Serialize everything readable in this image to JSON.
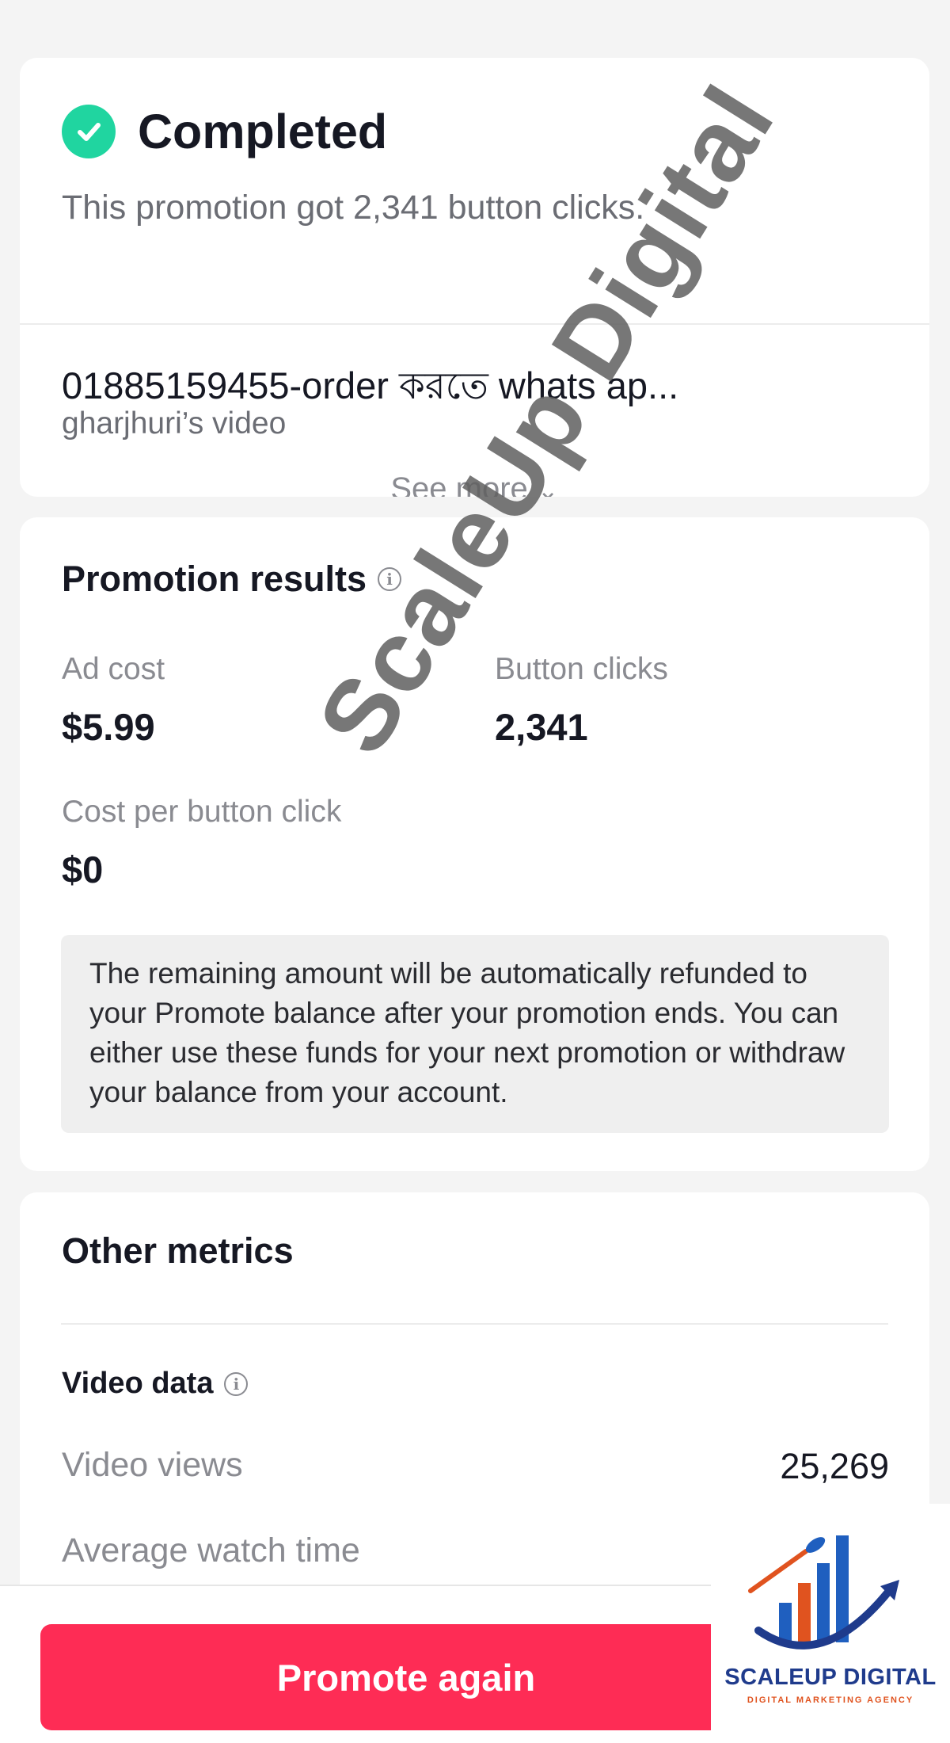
{
  "status": {
    "title": "Completed",
    "subtitle": "This promotion got 2,341 button clicks."
  },
  "video": {
    "title": "01885159455-order করতে whats ap...",
    "owner": "gharjhuri’s video",
    "see_more_label": "See more"
  },
  "results": {
    "title": "Promotion results",
    "ad_cost_label": "Ad cost",
    "ad_cost_value": "$5.99",
    "button_clicks_label": "Button clicks",
    "button_clicks_value": "2,341",
    "cost_per_click_label": "Cost per button click",
    "cost_per_click_value": "$0",
    "refund_note": "The remaining amount will be automatically refunded to your Promote balance after your promotion ends. You can either use these funds for your next promotion or withdraw your balance from your account."
  },
  "other_metrics": {
    "title": "Other metrics",
    "video_data_label": "Video data",
    "video_views_label": "Video views",
    "video_views_value": "25,269",
    "avg_watch_time_label": "Average watch time"
  },
  "actions": {
    "promote_again_label": "Promote again"
  },
  "watermark": {
    "text": "ScaleUp Digital"
  },
  "logo": {
    "name": "SCALEUP DIGITAL",
    "tagline": "DIGITAL MARKETING AGENCY"
  },
  "colors": {
    "success": "#20d5a0",
    "primary_button": "#fe2c55",
    "logo_blue": "#1f3b8c",
    "logo_orange": "#e0531f"
  }
}
